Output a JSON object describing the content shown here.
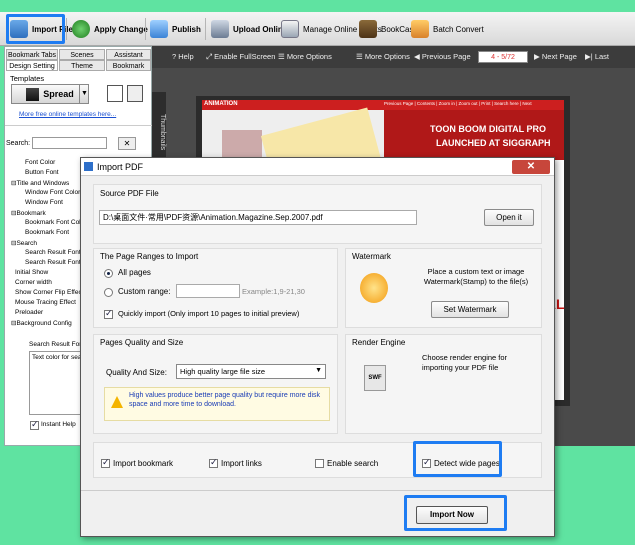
{
  "toolbar": {
    "import_file": "Import File",
    "apply_change": "Apply Change",
    "publish": "Publish",
    "upload_online": "Upload Online",
    "manage_online_books": "Manage Online Books",
    "bookcase": "BookCase",
    "batch_convert": "Batch Convert"
  },
  "left_panel": {
    "tabs": [
      "Bookmark Tabs",
      "Scenes",
      "Assistant",
      "Design Setting",
      "Theme",
      "Bookmark"
    ],
    "templates_label": "Templates",
    "template_name": "Spread",
    "more_templates_link": "More free online templates here...",
    "search_label": "Search:",
    "tree_items": [
      "Font Color",
      "Button Font",
      "⊟Title and Windows",
      "Window Font Color",
      "Window Font",
      "⊟Bookmark",
      "Bookmark Font Color",
      "Bookmark Font",
      "⊟Search",
      "Search Result Font",
      "Search Result Font",
      "Initial Show",
      "Corner width",
      "Show Corner Flip Effect",
      "Mouse Tracing Effect",
      "Preloader",
      "⊟Background Config"
    ],
    "desc_title": "Search Result Font",
    "desc_text": "Text color for sear",
    "instant_help": "Instant Help"
  },
  "viewer": {
    "help": "Help",
    "fullscreen": "Enable FullScreen",
    "more_options": "More Options",
    "more_options2": "More Options",
    "prev": "Previous Page",
    "page_indicator": "4 - 5/72",
    "next": "Next Page",
    "last": "Last",
    "thumbnails": "Thumbnails",
    "banner_line1": "TOON BOOM DIGITAL PRO",
    "banner_line2": "LAUNCHED AT SIGGRAPH",
    "side_text": "IAL",
    "logo_text": "ANIMATION",
    "page_nav_items": "Previous Page | Contents | Zoom in | Zoom out | Print | Search here | Next"
  },
  "dialog": {
    "title": "Import PDF",
    "close": "✕",
    "source_label": "Source PDF File",
    "source_path": "D:\\桌面文件·常用\\PDF资源\\Animation.Magazine.Sep.2007.pdf",
    "open_it": "Open it",
    "page_ranges_label": "The Page Ranges to Import",
    "all_pages": "All pages",
    "custom_range": "Custom range:",
    "example": "Example:1,9-21,30",
    "quickly_import": "Quickly import (Only import 10 pages to  initial  preview)",
    "watermark_label": "Watermark",
    "watermark_desc": "Place a custom text or image Watermark(Stamp) to the file(s)",
    "set_watermark": "Set Watermark",
    "quality_label": "Pages Quality and Size",
    "quality_size": "Quality And Size:",
    "quality_value": "High quality large file size",
    "quality_warning": "High values produce better page quality but require more disk space and more time to download.",
    "render_label": "Render Engine",
    "render_desc": "Choose render engine for importing your PDF file",
    "swf_label": "SWF",
    "import_bookmark": "Import bookmark",
    "import_links": "Import links",
    "enable_search": "Enable search",
    "detect_wide": "Detect wide pages",
    "import_now": "Import Now"
  },
  "colors": {
    "highlight": "#1e7cf2",
    "background": "#5fe3a1"
  }
}
